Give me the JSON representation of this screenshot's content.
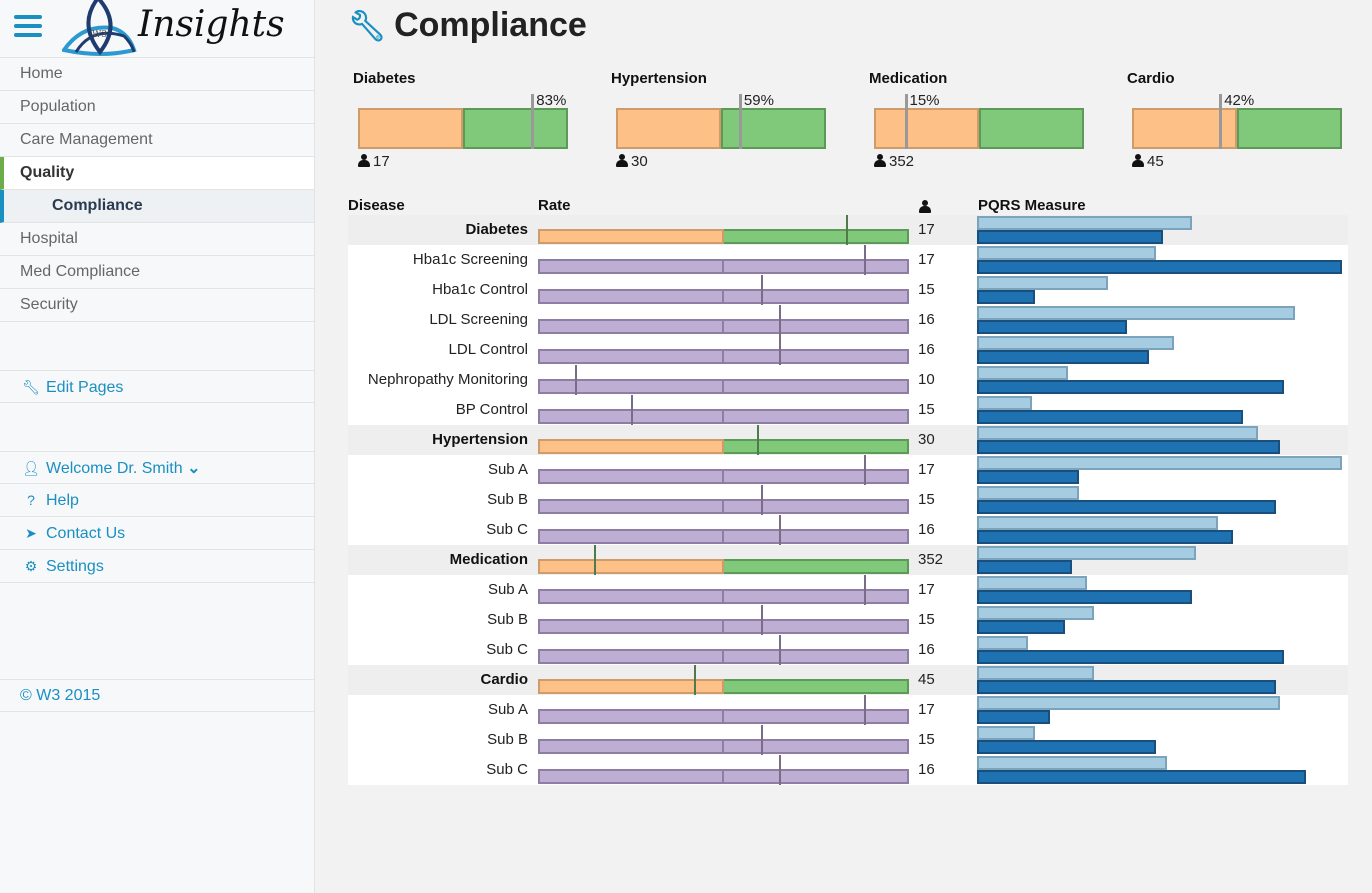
{
  "brand": {
    "name": "Insights",
    "logo_mark": "W3"
  },
  "nav": {
    "items": [
      {
        "label": "Home"
      },
      {
        "label": "Population"
      },
      {
        "label": "Care Management"
      },
      {
        "label": "Quality",
        "active": true
      },
      {
        "label": "Compliance",
        "sub": true
      },
      {
        "label": "Hospital"
      },
      {
        "label": "Med Compliance"
      },
      {
        "label": "Security"
      }
    ],
    "edit_pages": "Edit Pages",
    "user_items": [
      {
        "label": "Welcome Dr. Smith",
        "icon": "user-icon"
      },
      {
        "label": "Help",
        "icon": "question-icon"
      },
      {
        "label": "Contact Us",
        "icon": "paper-plane-icon"
      },
      {
        "label": "Settings",
        "icon": "gear-icon"
      }
    ],
    "footer": "© W3 2015"
  },
  "page": {
    "title": "Compliance",
    "icon": "wrench-icon"
  },
  "colors": {
    "accent": "#1a8fc2",
    "below": "#fdc087",
    "above": "#80c97b",
    "sub_rate": "#bfaed4",
    "pqrs_light": "#a6cce2",
    "pqrs_dark": "#1f72b1"
  },
  "summary": [
    {
      "name": "Diabetes",
      "pct": "83%",
      "rate": 0.83,
      "count": "17"
    },
    {
      "name": "Hypertension",
      "pct": "59%",
      "rate": 0.59,
      "count": "30"
    },
    {
      "name": "Medication",
      "pct": "15%",
      "rate": 0.15,
      "count": "352"
    },
    {
      "name": "Cardio",
      "pct": "42%",
      "rate": 0.42,
      "count": "45"
    }
  ],
  "table": {
    "headers": {
      "disease": "Disease",
      "rate": "Rate",
      "pqrs": "PQRS Measure"
    },
    "rows": [
      {
        "name": "Diabetes",
        "group": true,
        "rate": 0.83,
        "count": "17",
        "pqrs": [
          0.59,
          0.51
        ]
      },
      {
        "name": "Hba1c Screening",
        "rate": 0.88,
        "count": "17",
        "pqrs": [
          0.49,
          1.0
        ]
      },
      {
        "name": "Hba1c Control",
        "rate": 0.6,
        "count": "15",
        "pqrs": [
          0.36,
          0.16
        ]
      },
      {
        "name": "LDL Screening",
        "rate": 0.65,
        "count": "16",
        "pqrs": [
          0.87,
          0.41
        ]
      },
      {
        "name": "LDL Control",
        "rate": 0.65,
        "count": "16",
        "pqrs": [
          0.54,
          0.47
        ]
      },
      {
        "name": "Nephropathy Monitoring",
        "rate": 0.1,
        "count": "10",
        "pqrs": [
          0.25,
          0.84
        ]
      },
      {
        "name": "BP Control",
        "rate": 0.25,
        "count": "15",
        "pqrs": [
          0.15,
          0.73
        ]
      },
      {
        "name": "Hypertension",
        "group": true,
        "rate": 0.59,
        "count": "30",
        "pqrs": [
          0.77,
          0.83
        ]
      },
      {
        "name": "Sub A",
        "rate": 0.88,
        "count": "17",
        "pqrs": [
          1.0,
          0.28
        ]
      },
      {
        "name": "Sub B",
        "rate": 0.6,
        "count": "15",
        "pqrs": [
          0.28,
          0.82
        ]
      },
      {
        "name": "Sub C",
        "rate": 0.65,
        "count": "16",
        "pqrs": [
          0.66,
          0.7
        ]
      },
      {
        "name": "Medication",
        "group": true,
        "rate": 0.15,
        "count": "352",
        "pqrs": [
          0.6,
          0.26
        ]
      },
      {
        "name": "Sub A",
        "rate": 0.88,
        "count": "17",
        "pqrs": [
          0.3,
          0.59
        ]
      },
      {
        "name": "Sub B",
        "rate": 0.6,
        "count": "15",
        "pqrs": [
          0.32,
          0.24
        ]
      },
      {
        "name": "Sub C",
        "rate": 0.65,
        "count": "16",
        "pqrs": [
          0.14,
          0.84
        ]
      },
      {
        "name": "Cardio",
        "group": true,
        "rate": 0.42,
        "count": "45",
        "pqrs": [
          0.32,
          0.82
        ]
      },
      {
        "name": "Sub A",
        "rate": 0.88,
        "count": "17",
        "pqrs": [
          0.83,
          0.2
        ]
      },
      {
        "name": "Sub B",
        "rate": 0.6,
        "count": "15",
        "pqrs": [
          0.16,
          0.49
        ]
      },
      {
        "name": "Sub C",
        "rate": 0.65,
        "count": "16",
        "pqrs": [
          0.52,
          0.9
        ]
      }
    ]
  }
}
